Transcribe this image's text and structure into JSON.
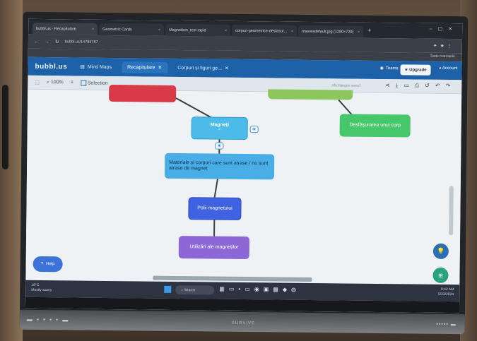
{
  "browser": {
    "tabs": [
      {
        "label": "bubbl.us - Recapitulare",
        "active": true
      },
      {
        "label": "Geometric Cards"
      },
      {
        "label": "Magnetism_test rapid"
      },
      {
        "label": "corpuri-geometrice-desfasur..."
      },
      {
        "label": "maxresdefault.jpg (1280×720)"
      }
    ],
    "new_tab": "+",
    "url": "bubbl.us/14785787",
    "all_bookmarks": "Toate marcajele"
  },
  "app": {
    "logo": "bubbl.us",
    "tabs": [
      {
        "label": "Mind Maps"
      },
      {
        "label": "Recapitulare",
        "active": true
      },
      {
        "label": "Corpuri și figuri ge..."
      }
    ],
    "teams_label": "Teams",
    "upgrade_label": "Upgrade",
    "account_label": "Account"
  },
  "toolbar": {
    "zoom": "100%",
    "selection_label": "Selection",
    "saved_status": "All changes saved"
  },
  "mindmap": {
    "nodes": {
      "magneti": "Magneți",
      "desfasurarea": "Desfășurarea unui corp",
      "materiale": "Materiale și corpuri care sunt atrase / nu sunt atrase de magnet",
      "poli": "Polii magnetului",
      "utilizari": "Utilizări ale magneților"
    },
    "colors": {
      "magneti": "#4dbbea",
      "desfasurarea": "#47c76b",
      "materiale": "#4aaee6",
      "poli": "#3f63e0",
      "utilizari": "#8e67d6",
      "red_node": "#d83a48"
    }
  },
  "help_label": "Help",
  "taskbar": {
    "weather_temp": "19°C",
    "weather_desc": "Mostly sunny",
    "search_placeholder": "Search",
    "time": "9:42 AM",
    "date": "5/23/2024"
  },
  "monitor": {
    "brand": "SURVIVE"
  }
}
